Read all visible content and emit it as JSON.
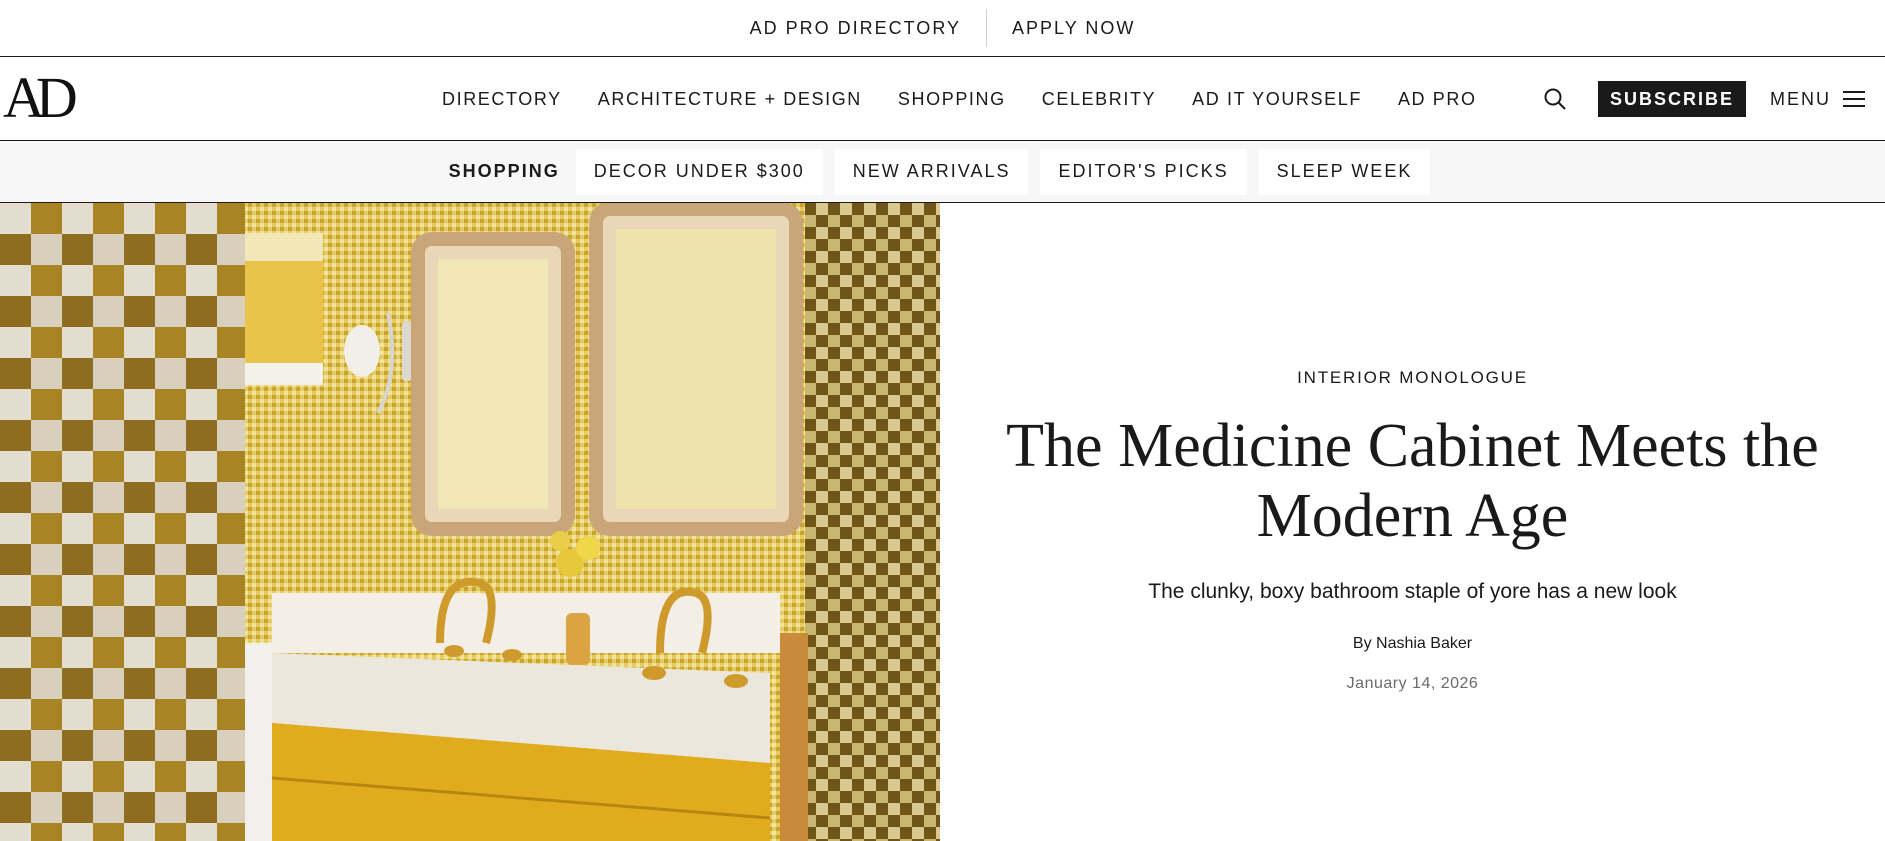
{
  "utility_bar": {
    "links": [
      "AD PRO DIRECTORY",
      "APPLY NOW"
    ]
  },
  "brand": {
    "logo_text": "AD"
  },
  "main_nav": {
    "links": [
      "DIRECTORY",
      "ARCHITECTURE + DESIGN",
      "SHOPPING",
      "CELEBRITY",
      "AD IT YOURSELF",
      "AD PRO"
    ],
    "search_icon": "search-icon",
    "subscribe_label": "SUBSCRIBE",
    "menu_label": "MENU",
    "menu_icon": "hamburger-icon"
  },
  "sub_nav": {
    "label": "SHOPPING",
    "items": [
      "DECOR UNDER $300",
      "NEW ARRIVALS",
      "EDITOR'S PICKS",
      "SLEEP WEEK"
    ]
  },
  "article": {
    "rubric": "INTERIOR MONOLOGUE",
    "headline": "The Medicine Cabinet Meets the Modern Age",
    "dek": "The clunky, boxy bathroom staple of yore has a new look",
    "byline": "By Nashia Baker",
    "date": "January 14, 2026"
  },
  "colors": {
    "text": "#1a1a1a",
    "subscribe_bg": "#1a1a1a",
    "subnav_bg": "#f7f7f7",
    "date_text": "#6b6b6b",
    "vanity_yellow": "#e0ac1e",
    "tile_gold": "#d9b84a",
    "brass": "#cf9a2c"
  }
}
